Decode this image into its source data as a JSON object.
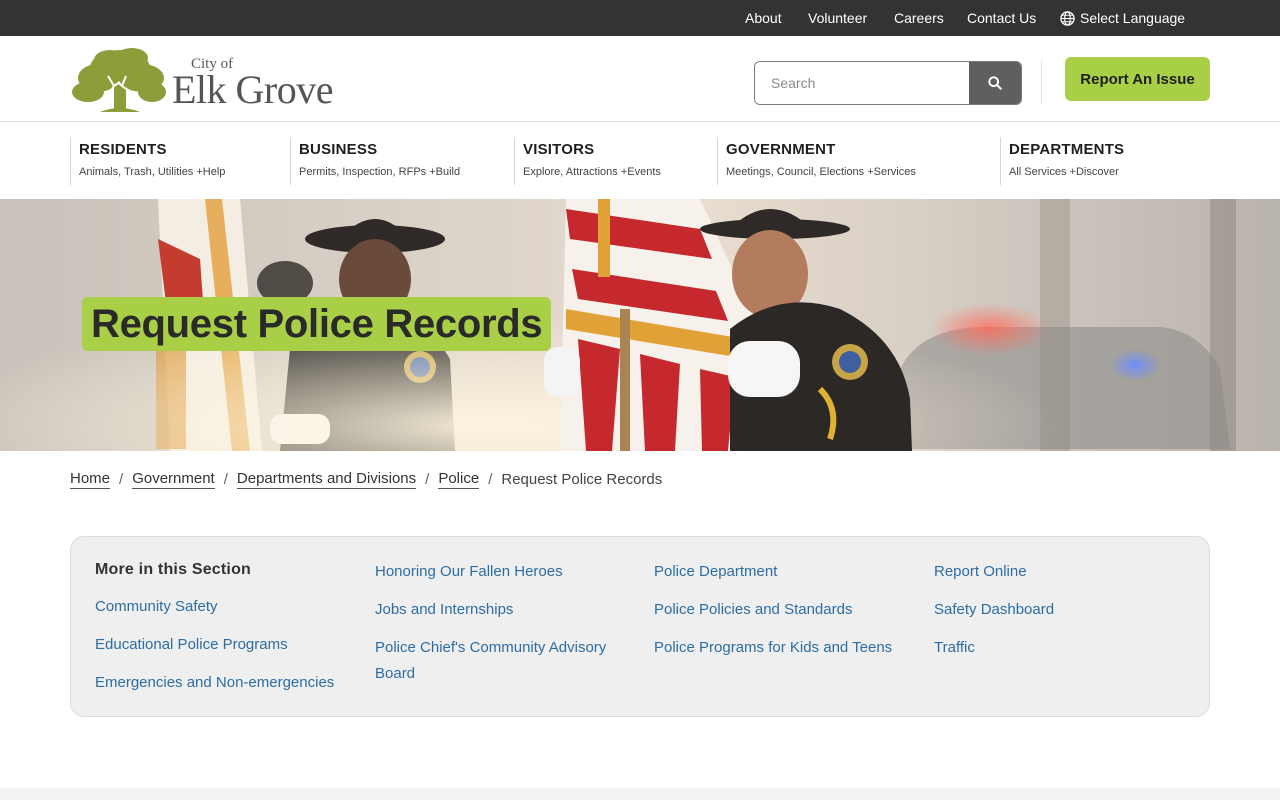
{
  "topbar": {
    "links": [
      "About",
      "Volunteer",
      "Careers",
      "Contact Us"
    ],
    "language_label": "Select Language"
  },
  "header": {
    "logo_small": "City of",
    "logo_big": "Elk Grove",
    "search_placeholder": "Search",
    "report_label": "Report An Issue"
  },
  "nav": [
    {
      "title": "RESIDENTS",
      "sub": "Animals, Trash, Utilities +Help"
    },
    {
      "title": "BUSINESS",
      "sub": "Permits, Inspection, RFPs +Build"
    },
    {
      "title": "VISITORS",
      "sub": "Explore, Attractions +Events"
    },
    {
      "title": "GOVERNMENT",
      "sub": "Meetings, Council, Elections +Services"
    },
    {
      "title": "DEPARTMENTS",
      "sub": "All Services +Discover"
    }
  ],
  "hero": {
    "title": "Request Police Records"
  },
  "breadcrumb": {
    "links": [
      "Home",
      "Government",
      "Departments and Divisions",
      "Police"
    ],
    "current": "Request Police Records"
  },
  "section": {
    "heading": "More in this Section",
    "col1": [
      "Community Safety",
      "Educational Police Programs",
      "Emergencies and Non-emergencies"
    ],
    "col2": [
      "Honoring Our Fallen Heroes",
      "Jobs and Internships",
      "Police Chief's Community Advisory Board"
    ],
    "col3": [
      "Police Department",
      "Police Policies and Standards",
      "Police Programs for Kids and Teens"
    ],
    "col4": [
      "Report Online",
      "Safety Dashboard",
      "Traffic"
    ]
  },
  "colors": {
    "accent_green": "#a8cf45",
    "link_blue": "#2d6da3",
    "topbar_bg": "#333333",
    "logo_olive": "#8f9c3a"
  }
}
